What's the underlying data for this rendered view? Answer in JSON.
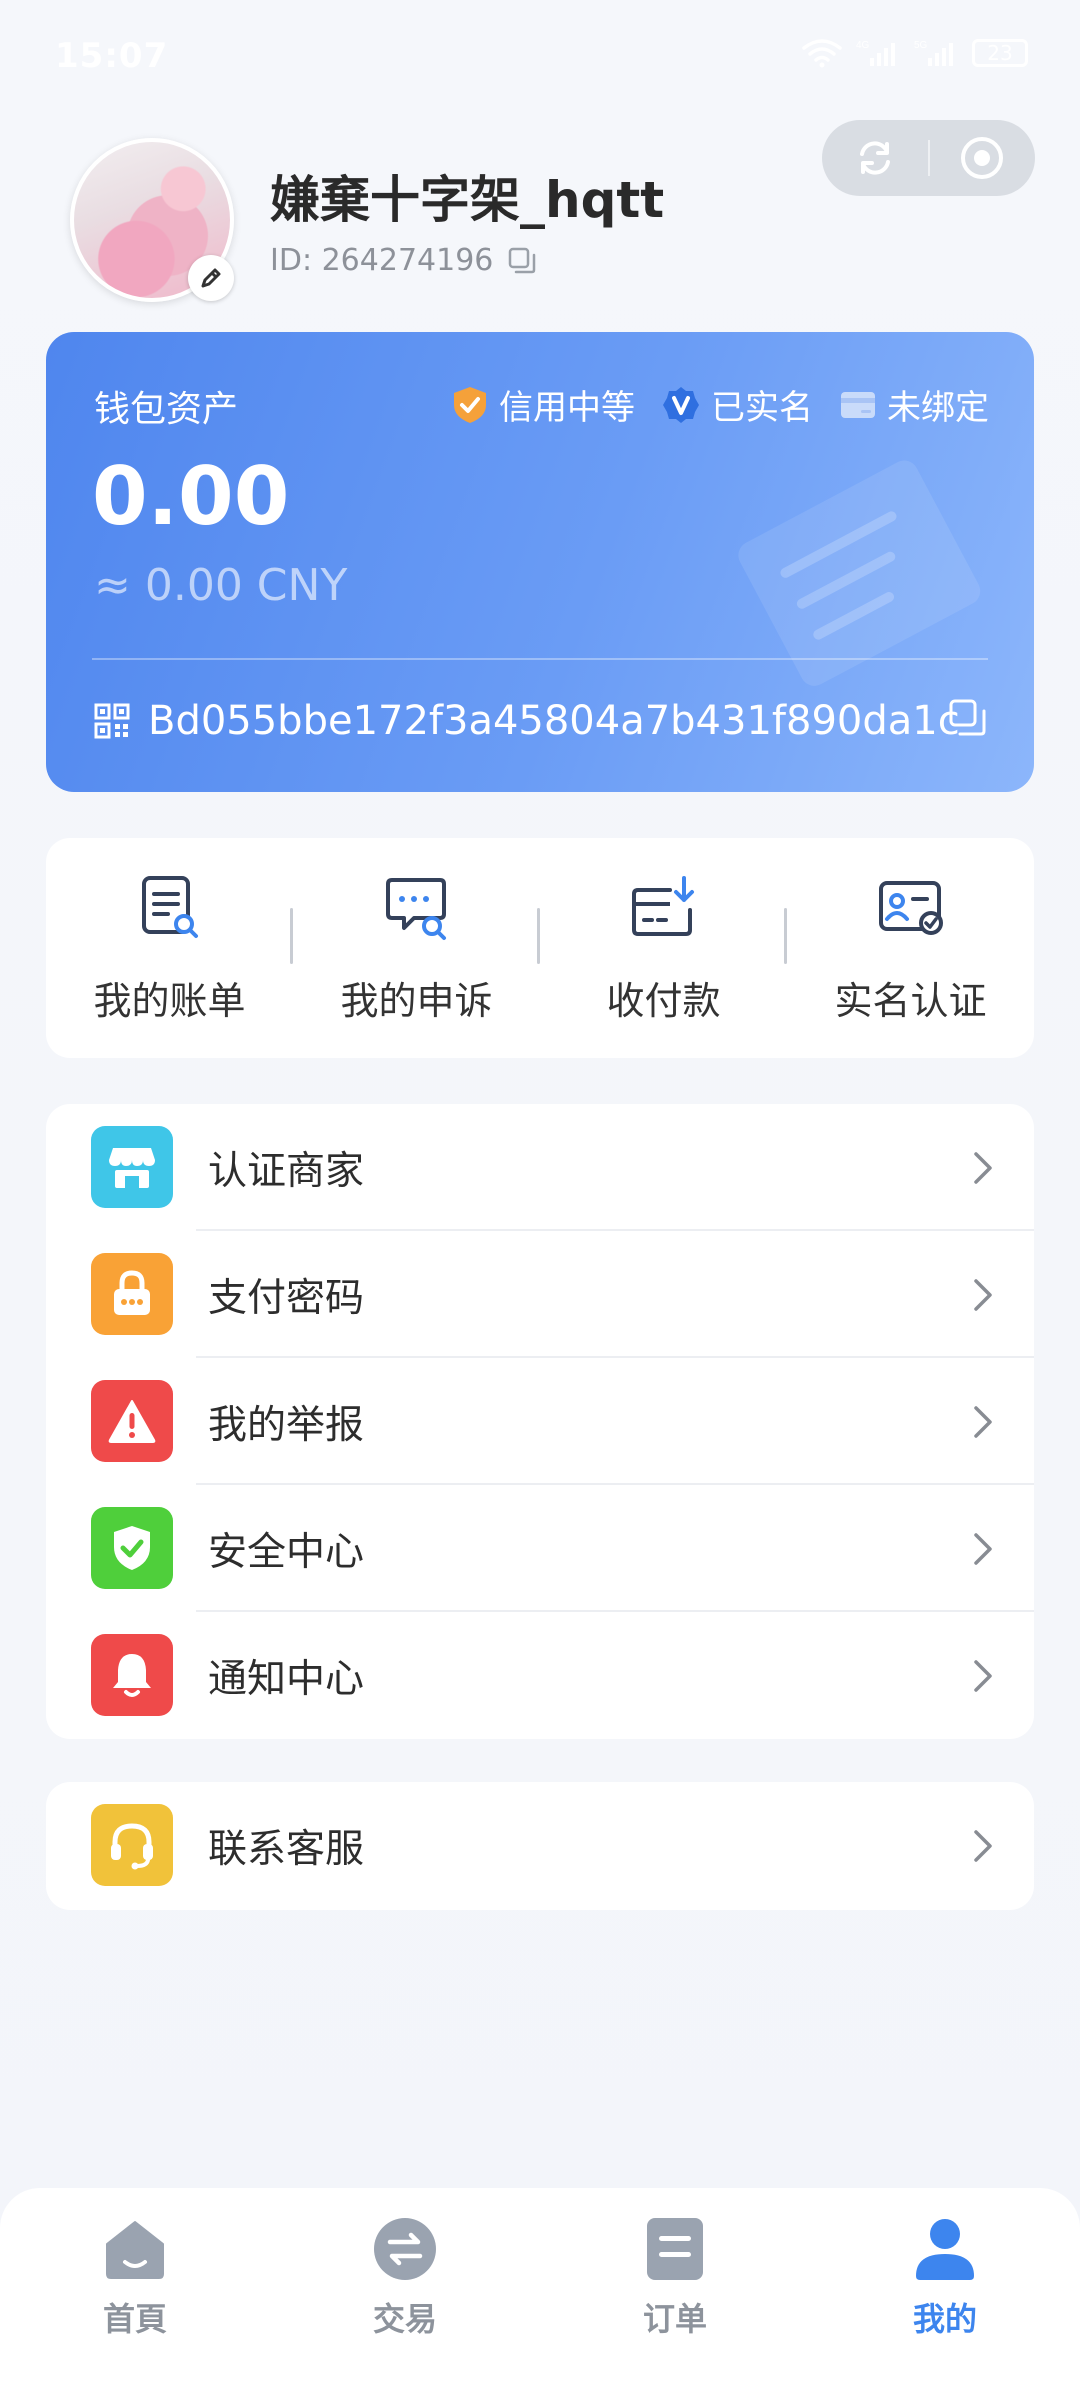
{
  "status_bar": {
    "time": "15:07",
    "network_1": "4G",
    "network_2": "5G",
    "battery": "23"
  },
  "profile": {
    "username": "嫌棄十字架_hqtt",
    "user_id": "ID: 264274196"
  },
  "wallet": {
    "title": "钱包资产",
    "badges": [
      {
        "label": "信用中等",
        "icon": "shield-check-icon",
        "color": "#f5a13a"
      },
      {
        "label": "已实名",
        "icon": "verified-v-icon",
        "color": "#2f6fe0"
      },
      {
        "label": "未绑定",
        "icon": "card-icon",
        "color": "#c9dbfa"
      }
    ],
    "balance": "0.00",
    "cny": "≈ 0.00 CNY",
    "address": "Bd055bbe172f3a45804a7b431f890da1c",
    "gradient": [
      "#4f86ee",
      "#8cb6fb"
    ]
  },
  "quick_actions": [
    {
      "label": "我的账单",
      "icon": "bill-search-icon"
    },
    {
      "label": "我的申诉",
      "icon": "chat-search-icon"
    },
    {
      "label": "收付款",
      "icon": "wallet-download-icon"
    },
    {
      "label": "实名认证",
      "icon": "id-card-verified-icon"
    }
  ],
  "menu": [
    {
      "label": "认证商家",
      "icon": "store-icon",
      "color": "#3fc6e8"
    },
    {
      "label": "支付密码",
      "icon": "lock-icon",
      "color": "#f9a236"
    },
    {
      "label": "我的举报",
      "icon": "warning-icon",
      "color": "#ef4a4a"
    },
    {
      "label": "安全中心",
      "icon": "shield-icon",
      "color": "#4fcf3b"
    },
    {
      "label": "通知中心",
      "icon": "bell-icon",
      "color": "#ef4a4a"
    }
  ],
  "menu2": [
    {
      "label": "联系客服",
      "icon": "headset-icon",
      "color": "#f1c23a"
    }
  ],
  "tabs": [
    {
      "label": "首頁",
      "icon": "home-icon",
      "active": false
    },
    {
      "label": "交易",
      "icon": "exchange-icon",
      "active": false
    },
    {
      "label": "订单",
      "icon": "order-icon",
      "active": false
    },
    {
      "label": "我的",
      "icon": "user-icon",
      "active": true
    }
  ],
  "colors": {
    "accent": "#3d85ee",
    "tab_inactive": "#8d939c",
    "background": "#f3f5fa"
  }
}
